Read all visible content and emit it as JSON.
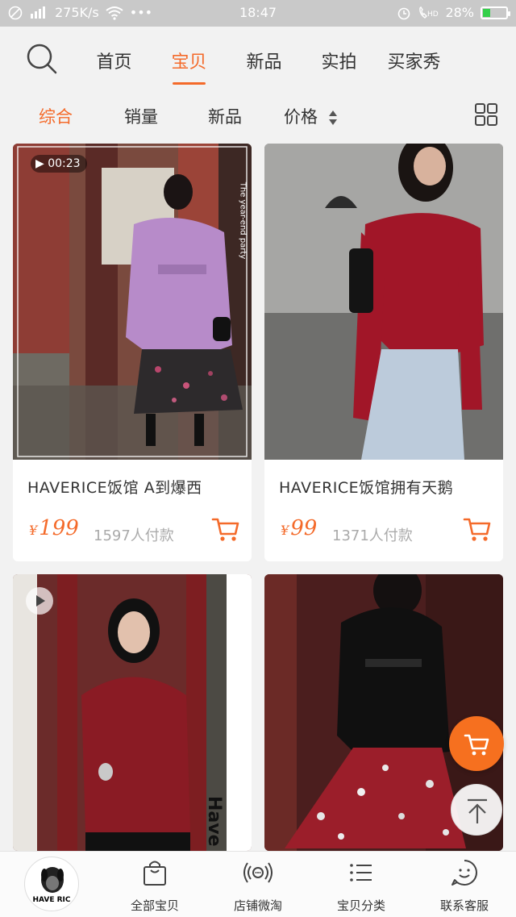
{
  "status_bar": {
    "speed": "275K/s",
    "dots": "•••",
    "time": "18:47",
    "battery": "28%"
  },
  "top_tabs": [
    "首页",
    "宝贝",
    "新品",
    "实拍",
    "买家秀"
  ],
  "sort_options": [
    "综合",
    "销量",
    "新品",
    "价格"
  ],
  "products": [
    {
      "title": "HAVERICE饭馆 A到爆西",
      "currency": "¥",
      "price": "199",
      "sold": "1597人付款",
      "video_duration": "00:23",
      "image_overlay_text": "The year-end party"
    },
    {
      "title": "HAVERICE饭馆拥有天鹅",
      "currency": "¥",
      "price": "99",
      "sold": "1371人付款"
    },
    {
      "image_overlay_text": "Have Ric"
    },
    {}
  ],
  "bottom_nav": {
    "logo_text": "HAVE RIC",
    "items": [
      "全部宝贝",
      "店铺微淘",
      "宝贝分类",
      "联系客服"
    ]
  },
  "colors": {
    "accent": "#f46a2a",
    "status_bar": "#c9c9c9",
    "background": "#f2f2f2"
  }
}
